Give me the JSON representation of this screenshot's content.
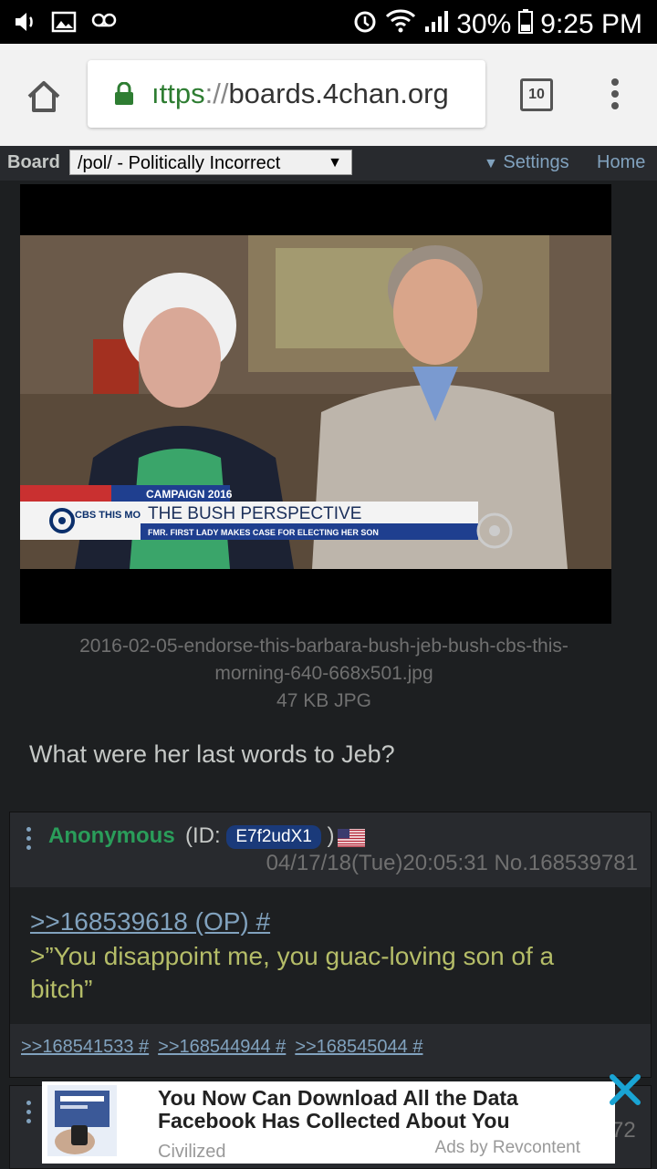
{
  "statusbar": {
    "battery": "30%",
    "time": "9:25 PM"
  },
  "browser": {
    "url_scheme": "ıttps",
    "url_sep": "://",
    "url_host": "boards.4chan.org",
    "tab_count": "10"
  },
  "boardbar": {
    "label": "Board",
    "selected": "/pol/ - Politically Incorrect",
    "settings": "Settings",
    "home": "Home"
  },
  "op": {
    "thumb": {
      "banner_top": "CAMPAIGN 2016",
      "banner_logo": "CBS THIS MORNING",
      "banner_title": "THE BUSH PERSPECTIVE",
      "banner_sub": "FMR. FIRST LADY MAKES CASE FOR ELECTING HER SON"
    },
    "filename_line1": "2016-02-05-endorse-this-barbara-bush-jeb-bush-cbs-this-",
    "filename_line2": "morning-640-668x501.jpg",
    "fileinfo": "47 KB JPG",
    "comment": "What were her last words to Jeb?"
  },
  "reply": {
    "name": "Anonymous",
    "id_prefix": "(ID:",
    "id": "E7f2udX1",
    "id_suffix": ")",
    "datetime": "04/17/18(Tue)20:05:31 No.168539781",
    "quotelink": ">>168539618 (OP) #",
    "greentext": ">”You disappoint me, you guac-loving son of a bitch”",
    "backlinks": [
      ">>168541533 #",
      ">>168544944 #",
      ">>168545044 #"
    ]
  },
  "next_post_number_fragment": "72",
  "ad": {
    "title": "You Now Can Download All the Data Facebook Has Collected About You",
    "source": "Civilized",
    "by": "Ads by Revcontent"
  },
  "colors": {
    "background": "#1d1f21",
    "post_bg": "#282a2e",
    "link": "#81a2be",
    "name": "#2a9d5a",
    "greentext": "#b5bd68",
    "meta": "#707070"
  }
}
